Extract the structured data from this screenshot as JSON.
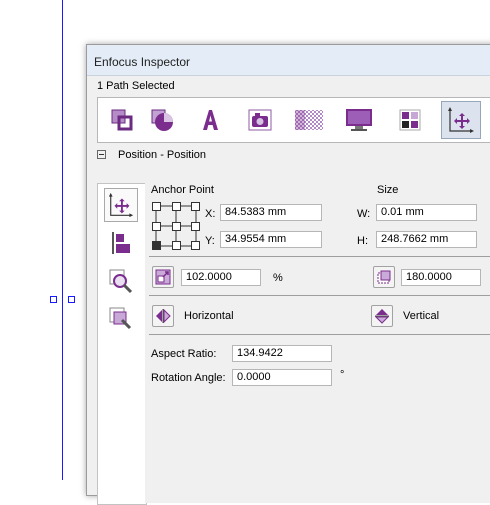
{
  "window": {
    "title": "Enfocus Inspector",
    "status": "1 Path Selected"
  },
  "toolbar": {
    "icons": [
      "fill-stroke-icon",
      "shape-icon",
      "text-icon",
      "image-icon",
      "transparency-icon",
      "monitor-icon",
      "colors-icon",
      "position-icon"
    ]
  },
  "section": {
    "title": "Position - Position"
  },
  "anchor": {
    "label": "Anchor Point",
    "x_label": "X:",
    "x_value": "84.5383 mm",
    "y_label": "Y:",
    "y_value": "34.9554 mm"
  },
  "size": {
    "label": "Size",
    "w_label": "W:",
    "w_value": "0.01 mm",
    "h_label": "H:",
    "h_value": "248.7662 mm"
  },
  "scale": {
    "value": "102.0000",
    "unit": "%"
  },
  "rotate": {
    "value": "180.0000"
  },
  "flip": {
    "horizontal": "Horizontal",
    "vertical": "Vertical"
  },
  "aspect": {
    "label": "Aspect Ratio:",
    "value": "134.9422"
  },
  "rotation": {
    "label": "Rotation Angle:",
    "value": "0.0000",
    "unit": "°"
  },
  "colors": {
    "accent": "#7b2d8e",
    "guide": "#1a1aff"
  }
}
